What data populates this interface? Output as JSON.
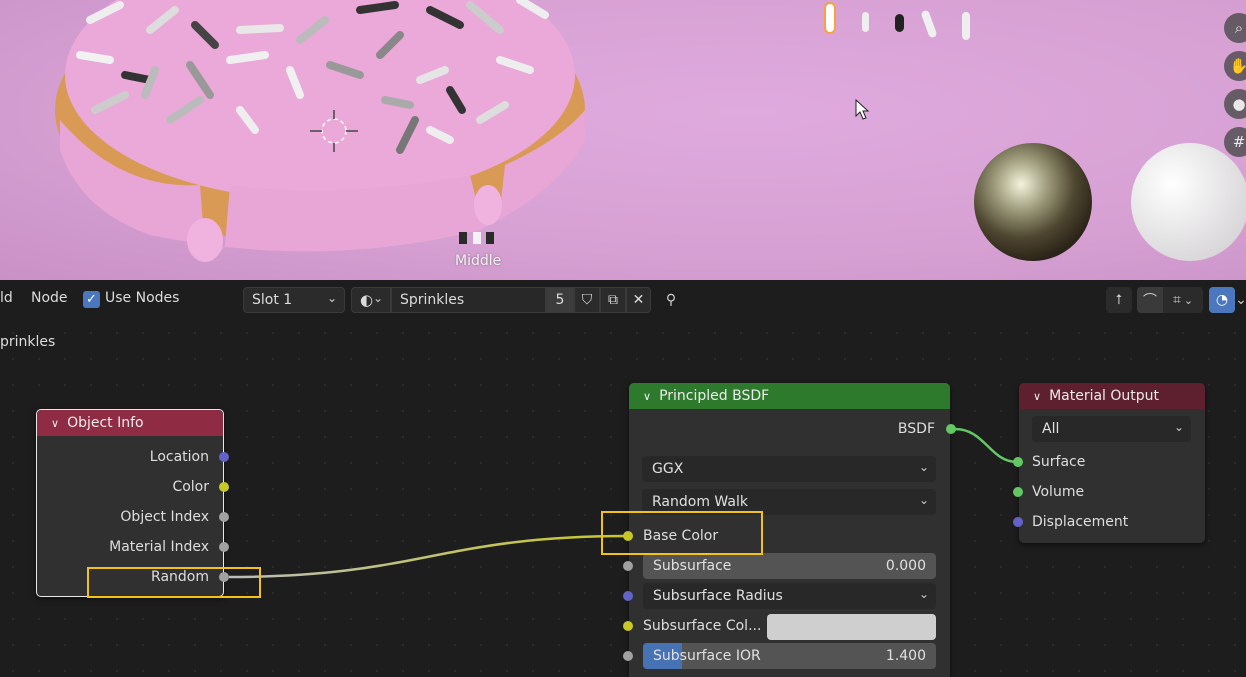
{
  "viewport": {
    "label": "Middle",
    "tools": [
      "zoom-icon",
      "pan-hand-icon",
      "camera-icon",
      "grid-icon"
    ]
  },
  "header": {
    "menu_partial": "ld",
    "menu_node": "Node",
    "use_nodes_label": "Use Nodes",
    "use_nodes_checked": true,
    "slot": "Slot 1",
    "material_name": "Sprinkles",
    "user_count": "5"
  },
  "breadcrumb": "prinkles",
  "nodes": {
    "object_info": {
      "title": "Object Info",
      "outputs": [
        "Location",
        "Color",
        "Object Index",
        "Material Index",
        "Random"
      ]
    },
    "principled": {
      "title": "Principled BSDF",
      "output": "BSDF",
      "distribution": "GGX",
      "subsurface_method": "Random Walk",
      "base_color": "Base Color",
      "subsurface": {
        "label": "Subsurface",
        "value": "0.000"
      },
      "subsurface_radius": "Subsurface Radius",
      "subsurface_color": "Subsurface Col...",
      "subsurface_ior": {
        "label": "Subsurface IOR",
        "value": "1.400"
      }
    },
    "material_output": {
      "title": "Material Output",
      "target": "All",
      "inputs": [
        "Surface",
        "Volume",
        "Displacement"
      ]
    }
  },
  "colors": {
    "object_info_header": "#8f2c44",
    "principled_header": "#2d7a2d",
    "output_header": "#5e1f2e",
    "highlight": "#f2c21a"
  }
}
